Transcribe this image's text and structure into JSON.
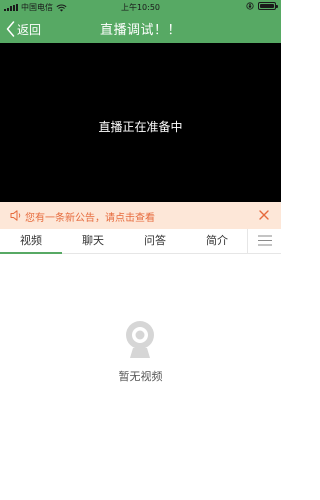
{
  "status_bar": {
    "carrier": "中国电信",
    "time": "上午10:50"
  },
  "nav": {
    "back_label": "返回",
    "title": "直播调试！！"
  },
  "player": {
    "status_text": "直播正在准备中"
  },
  "notice": {
    "text": "您有一条新公告，请点击查看"
  },
  "tabs": [
    {
      "label": "视频",
      "active": true
    },
    {
      "label": "聊天",
      "active": false
    },
    {
      "label": "问答",
      "active": false
    },
    {
      "label": "简介",
      "active": false
    }
  ],
  "empty_state": {
    "icon": "webcam-icon",
    "text": "暂无视频"
  },
  "colors": {
    "header": "#57a964",
    "notice_bg": "#fde7d8",
    "notice_text": "#e66a3c"
  }
}
